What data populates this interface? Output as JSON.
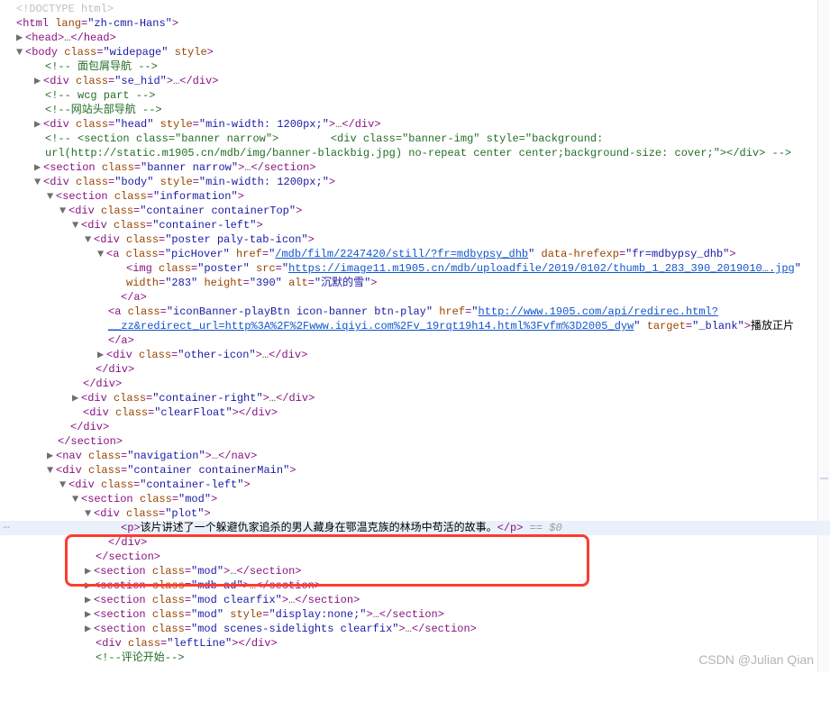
{
  "watermark": "CSDN @Julian Qian",
  "arrows": {
    "down": "▼",
    "right": "▶"
  },
  "ellipsis": "…",
  "eq0": " == $0",
  "t": {
    "doctype_open": "<!",
    "doctype_word": "DOCTYPE",
    "doctype_html": " html",
    "gt": ">",
    "html_open": "<html ",
    "lang_attr": "lang",
    "lang_val": "\"zh-cmn-Hans\"",
    "head_open": "<head>",
    "head_close": "</head>",
    "body_open": "<body ",
    "class_attr": "class",
    "body_class": "\"widepage\"",
    "style_attr": "style",
    "c_breadcrumb": "<!-- 面包屑导航 -->",
    "div_open": "<div ",
    "div_close": "</div>",
    "sehid_val": "\"se_hid\"",
    "c_wcg": "<!-- wcg part -->",
    "c_header_nav": "<!--网站头部导航 -->",
    "head_class": "\"head\"",
    "minwidth": "\"min-width: 1200px;\"",
    "c_banner_full": "<!-- <section class=\"banner narrow\">        <div class=\"banner-img\" style=\"background: url(http://static.m1905.cn/mdb/img/banner-blackbig.jpg) no-repeat center center;background-size: cover;\"></div> -->",
    "section_open": "<section ",
    "section_close": "</section>",
    "banner_class": "\"banner narrow\"",
    "body_div_class": "\"body\"",
    "info_class": "\"information\"",
    "container_top": "\"container containerTop\"",
    "container_left": "\"container-left\"",
    "poster_class": "\"poster paly-tab-icon\"",
    "a_open": "<a ",
    "a_close": "</a>",
    "pichover": "\"picHover\"",
    "href_attr": "href",
    "pichover_href": "/mdb/film/2247420/still/?fr=mdbypsy_dhb",
    "datahrefexp_attr": "data-hrefexp",
    "datahrefexp_val": "\"fr=mdbypsy_dhb\"",
    "img_open": "<img ",
    "poster_img_class": "\"poster\"",
    "src_attr": "src",
    "poster_src": "https://image11.m1905.cn/mdb/uploadfile/2019/0102/thumb_1_283_390_2019010….jpg",
    "width_attr": "width",
    "w283": "\"283\"",
    "height_attr": "height",
    "h390": "\"390\"",
    "alt_attr": "alt",
    "alt_val": "\"沉默的雪\"",
    "iconbanner_class": "\"iconBanner-playBtn icon-banner btn-play\"",
    "iconbanner_href": "http://www.1905.com/api/redirec.html?__zz&redirect_url=http%3A%2F%2Fwww.iqiyi.com%2Fv_19rqt19h14.html%3Fvfm%3D2005_dyw",
    "target_attr": "target",
    "target_blank": "\"_blank\"",
    "play_text": "播放正片",
    "other_icon": "\"other-icon\"",
    "container_right": "\"container-right\"",
    "clearfloat": "\"clearFloat\"",
    "nav_open": "<nav ",
    "nav_close": "</nav>",
    "navigation": "\"navigation\"",
    "container_main": "\"container containerMain\"",
    "mod_class": "\"mod\"",
    "plot_class": "\"plot\"",
    "p_open": "<p>",
    "p_close": "</p>",
    "plot_text": "该片讲述了一个躲避仇家追杀的男人藏身在鄂温克族的林场中苟活的故事。",
    "mdb_ad": "\"mdb-ad\"",
    "mod_clearfix": "\"mod clearfix\"",
    "display_none": "\"display:none;\"",
    "scenes_class": "\"mod scenes-sidelights clearfix\"",
    "leftline": "\"leftLine\"",
    "c_comments": "<!--评论开始-->"
  }
}
